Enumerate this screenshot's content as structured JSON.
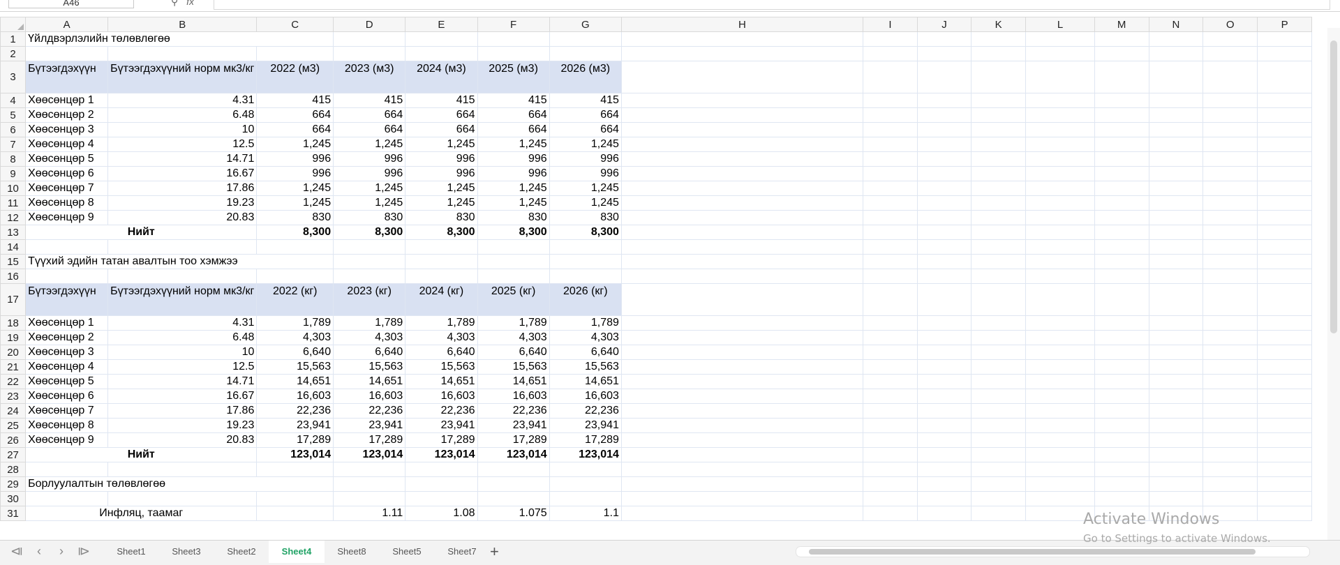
{
  "name_box": "A46",
  "icons": {
    "search": "search-icon",
    "fx": "fx-icon"
  },
  "columns": [
    "A",
    "B",
    "C",
    "D",
    "E",
    "F",
    "G",
    "H",
    "I",
    "J",
    "K",
    "L",
    "M",
    "N",
    "O",
    "P"
  ],
  "rows": [
    {
      "n": "1",
      "type": "title",
      "text": "Үйлдвэрлэлийн төлөвлөгөө"
    },
    {
      "n": "2",
      "type": "blank"
    },
    {
      "n": "3",
      "type": "header",
      "cells": [
        "Бүтээгдэхүүн",
        "Бүтээгдэхүүний норм мк3/кг",
        "2022 (м3)",
        "2023  (м3)",
        "2024  (м3)",
        "2025  (м3)",
        "2026  (м3)"
      ]
    },
    {
      "n": "4",
      "type": "data",
      "cells": [
        "Хөөсөнцөр 1",
        "4.31",
        "415",
        "415",
        "415",
        "415",
        "415"
      ]
    },
    {
      "n": "5",
      "type": "data",
      "cells": [
        "Хөөсөнцөр 2",
        "6.48",
        "664",
        "664",
        "664",
        "664",
        "664"
      ]
    },
    {
      "n": "6",
      "type": "data",
      "cells": [
        "Хөөсөнцөр 3",
        "10",
        "664",
        "664",
        "664",
        "664",
        "664"
      ]
    },
    {
      "n": "7",
      "type": "data",
      "cells": [
        "Хөөсөнцөр 4",
        "12.5",
        "1,245",
        "1,245",
        "1,245",
        "1,245",
        "1,245"
      ]
    },
    {
      "n": "8",
      "type": "data",
      "cells": [
        "Хөөсөнцөр 5",
        "14.71",
        "996",
        "996",
        "996",
        "996",
        "996"
      ]
    },
    {
      "n": "9",
      "type": "data",
      "cells": [
        "Хөөсөнцөр 6",
        "16.67",
        "996",
        "996",
        "996",
        "996",
        "996"
      ]
    },
    {
      "n": "10",
      "type": "data",
      "cells": [
        "Хөөсөнцөр 7",
        "17.86",
        "1,245",
        "1,245",
        "1,245",
        "1,245",
        "1,245"
      ]
    },
    {
      "n": "11",
      "type": "data",
      "cells": [
        "Хөөсөнцөр 8",
        "19.23",
        "1,245",
        "1,245",
        "1,245",
        "1,245",
        "1,245"
      ]
    },
    {
      "n": "12",
      "type": "data",
      "cells": [
        "Хөөсөнцөр 9",
        "20.83",
        "830",
        "830",
        "830",
        "830",
        "830"
      ]
    },
    {
      "n": "13",
      "type": "total",
      "cells": [
        "Нийт",
        "8,300",
        "8,300",
        "8,300",
        "8,300",
        "8,300"
      ]
    },
    {
      "n": "14",
      "type": "blank"
    },
    {
      "n": "15",
      "type": "title",
      "text": "Түүхий эдийн татан авалтын тоо хэмжээ"
    },
    {
      "n": "16",
      "type": "blank"
    },
    {
      "n": "17",
      "type": "header",
      "cells": [
        "Бүтээгдэхүүн",
        "Бүтээгдэхүүний норм мк3/кг",
        "2022 (кг)",
        "2023  (кг)",
        "2024   (кг)",
        "2025  (кг)",
        "2026  (кг)"
      ]
    },
    {
      "n": "18",
      "type": "data",
      "cells": [
        "Хөөсөнцөр 1",
        "4.31",
        "1,789",
        "1,789",
        "1,789",
        "1,789",
        "1,789"
      ]
    },
    {
      "n": "19",
      "type": "data",
      "cells": [
        "Хөөсөнцөр 2",
        "6.48",
        "4,303",
        "4,303",
        "4,303",
        "4,303",
        "4,303"
      ]
    },
    {
      "n": "20",
      "type": "data",
      "cells": [
        "Хөөсөнцөр 3",
        "10",
        "6,640",
        "6,640",
        "6,640",
        "6,640",
        "6,640"
      ]
    },
    {
      "n": "21",
      "type": "data",
      "cells": [
        "Хөөсөнцөр 4",
        "12.5",
        "15,563",
        "15,563",
        "15,563",
        "15,563",
        "15,563"
      ]
    },
    {
      "n": "22",
      "type": "data",
      "cells": [
        "Хөөсөнцөр 5",
        "14.71",
        "14,651",
        "14,651",
        "14,651",
        "14,651",
        "14,651"
      ]
    },
    {
      "n": "23",
      "type": "data",
      "cells": [
        "Хөөсөнцөр 6",
        "16.67",
        "16,603",
        "16,603",
        "16,603",
        "16,603",
        "16,603"
      ]
    },
    {
      "n": "24",
      "type": "data",
      "cells": [
        "Хөөсөнцөр 7",
        "17.86",
        "22,236",
        "22,236",
        "22,236",
        "22,236",
        "22,236"
      ]
    },
    {
      "n": "25",
      "type": "data",
      "cells": [
        "Хөөсөнцөр 8",
        "19.23",
        "23,941",
        "23,941",
        "23,941",
        "23,941",
        "23,941"
      ]
    },
    {
      "n": "26",
      "type": "data",
      "cells": [
        "Хөөсөнцөр 9",
        "20.83",
        "17,289",
        "17,289",
        "17,289",
        "17,289",
        "17,289"
      ]
    },
    {
      "n": "27",
      "type": "total",
      "cells": [
        "Нийт",
        "123,014",
        "123,014",
        "123,014",
        "123,014",
        "123,014"
      ]
    },
    {
      "n": "28",
      "type": "blank"
    },
    {
      "n": "29",
      "type": "title",
      "text": "Борлуулалтын төлөвлөгөө"
    },
    {
      "n": "30",
      "type": "blank"
    },
    {
      "n": "31",
      "type": "inflation",
      "cells": [
        "Инфляц, таамаг",
        "",
        "",
        "1.11",
        "1.08",
        "1.075",
        "1.1"
      ]
    }
  ],
  "sheet_tabs": [
    "Sheet1",
    "Sheet3",
    "Sheet2",
    "Sheet4",
    "Sheet8",
    "Sheet5",
    "Sheet7"
  ],
  "active_tab": "Sheet4",
  "activation": {
    "title": "Activate Windows",
    "subtitle": "Go to Settings to activate Windows."
  }
}
